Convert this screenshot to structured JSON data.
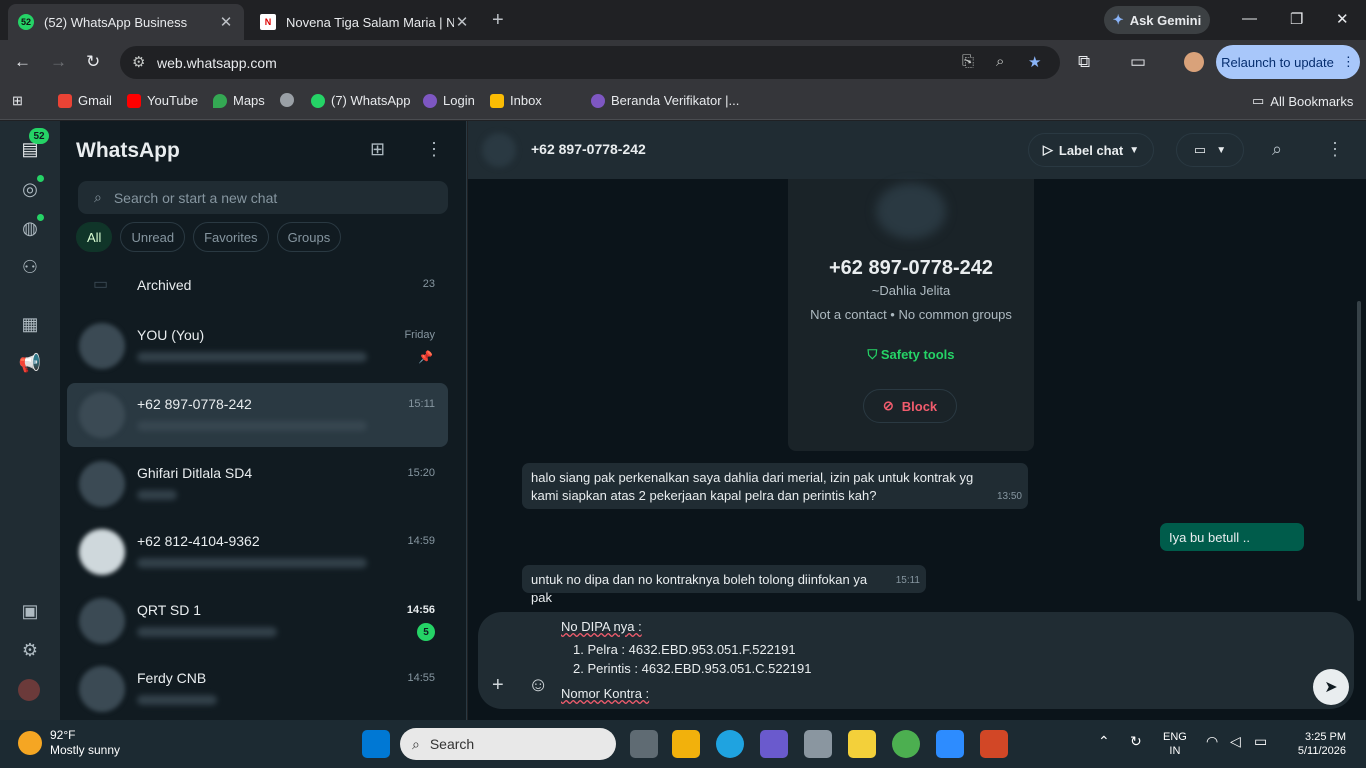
{
  "browser": {
    "tabs": [
      {
        "title": "(52) WhatsApp Business",
        "favicon": "52",
        "active": true
      },
      {
        "title": "Novena Tiga Salam Maria | Nov",
        "favicon": "N",
        "active": false
      }
    ],
    "ask_gemini": "Ask Gemini",
    "url": "web.whatsapp.com",
    "relaunch": "Relaunch to update",
    "bookmarks": [
      "Gmail",
      "YouTube",
      "Maps",
      "(7) WhatsApp",
      "Login",
      "Inbox",
      "Beranda Verifikator |..."
    ],
    "all_bookmarks": "All Bookmarks"
  },
  "wa_nav": {
    "badge": "52"
  },
  "chatlist": {
    "title": "WhatsApp",
    "search_placeholder": "Search or start a new chat",
    "filters": [
      "All",
      "Unread",
      "Favorites",
      "Groups"
    ],
    "archived": {
      "label": "Archived",
      "count": "23"
    },
    "chats": [
      {
        "name": "YOU (You)",
        "time": "Friday",
        "pinned": true
      },
      {
        "name": "+62 897-0778-242",
        "time": "15:11",
        "selected": true
      },
      {
        "name": "Ghifari Ditlala SD4",
        "time": "15:20"
      },
      {
        "name": "+62 812-4104-9362",
        "time": "14:59"
      },
      {
        "name": "QRT SD 1",
        "time": "14:56",
        "unread": "5"
      },
      {
        "name": "Ferdy CNB",
        "time": "14:55"
      }
    ]
  },
  "conversation": {
    "title": "+62 897-0778-242",
    "label_chat": "Label chat",
    "info": {
      "phone": "+62 897-0778-242",
      "name": "~Dahlia Jelita",
      "contact_status": "Not a contact • No common groups",
      "safety": "Safety tools",
      "block": "Block"
    },
    "messages": [
      {
        "dir": "in",
        "text": "halo siang pak perkenalkan saya dahlia dari merial, izin pak untuk kontrak yg kami siapkan atas 2 pekerjaan kapal pelra dan perintis kah?",
        "time": "13:50"
      },
      {
        "dir": "out",
        "text": "Iya bu betull .."
      },
      {
        "dir": "in",
        "text": "untuk no dipa dan no kontraknya boleh tolong diinfokan ya pak",
        "time": "15:11"
      }
    ],
    "draft": {
      "line1": "No DIPA nya :",
      "item1": "1. Pelra : 4632.EBD.953.051.F.522191",
      "item2": "2. Perintis : 4632.EBD.953.051.C.522191",
      "line4": "Nomor Kontra :"
    }
  },
  "taskbar": {
    "temp": "92°F",
    "condition": "Mostly sunny",
    "search": "Search",
    "lang": "ENG",
    "region": "IN",
    "time": "3:25 PM",
    "date": "5/11/2026"
  }
}
